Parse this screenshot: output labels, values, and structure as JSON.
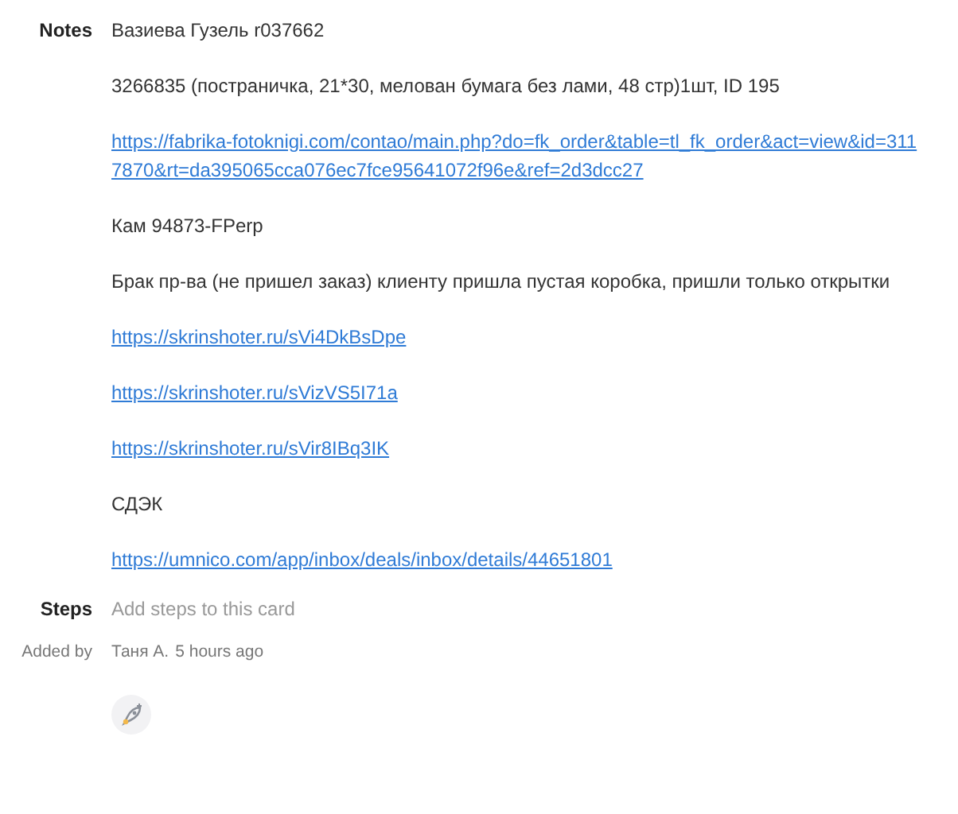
{
  "notes": {
    "label": "Notes",
    "items": [
      {
        "kind": "text",
        "text": "Вазиева Гузель r037662"
      },
      {
        "kind": "text",
        "text": "3266835 (постраничка, 21*30, мелован бумага без лами, 48 стр)1шт, ID 195"
      },
      {
        "kind": "link",
        "text": "https://fabrika-fotoknigi.com/contao/main.php?do=fk_order&table=tl_fk_order&act=view&id=3117870&rt=da395065cca076ec7fce95641072f96e&ref=2d3dcc27"
      },
      {
        "kind": "text",
        "text": "Кам 94873-FPerp"
      },
      {
        "kind": "text",
        "text": "Брак пр-ва (не пришел заказ) клиенту пришла пустая коробка, пришли только открытки"
      },
      {
        "kind": "link",
        "text": "https://skrinshoter.ru/sVi4DkBsDpe"
      },
      {
        "kind": "link",
        "text": "https://skrinshoter.ru/sVizVS5I71a"
      },
      {
        "kind": "link",
        "text": "https://skrinshoter.ru/sVir8IBq3IK"
      },
      {
        "kind": "text",
        "text": "СДЭК"
      },
      {
        "kind": "link",
        "text": "https://umnico.com/app/inbox/deals/inbox/details/44651801"
      }
    ]
  },
  "steps": {
    "label": "Steps",
    "placeholder": "Add steps to this card"
  },
  "added_by": {
    "label": "Added by",
    "author": "Таня А.",
    "time": "5 hours ago"
  }
}
